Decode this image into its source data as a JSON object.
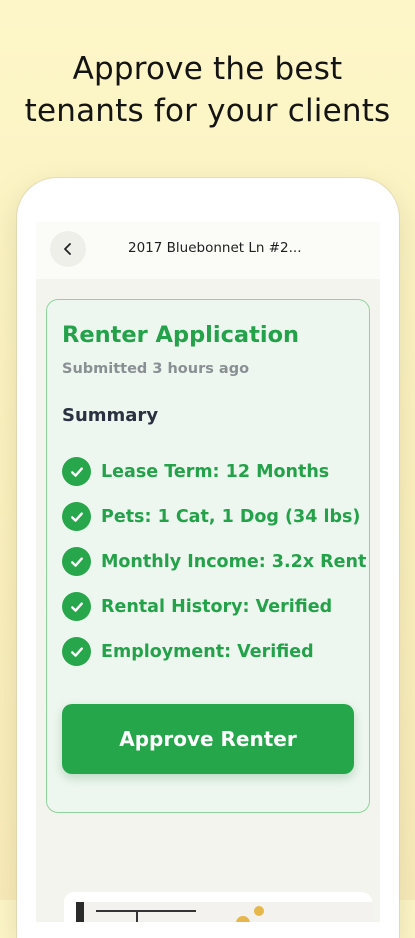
{
  "headline": {
    "line1": "Approve the best",
    "line2": "tenants for your clients"
  },
  "nav": {
    "title": "2017 Bluebonnet Ln #2..."
  },
  "application": {
    "title": "Renter Application",
    "submitted": "Submitted 3 hours ago",
    "summary_heading": "Summary",
    "items": [
      {
        "label": "Lease Term: 12 Months"
      },
      {
        "label": "Pets: 1 Cat, 1 Dog (34 lbs)"
      },
      {
        "label": "Monthly Income: 3.2x Rent"
      },
      {
        "label": "Rental History: Verified"
      },
      {
        "label": "Employment: Verified"
      }
    ],
    "approve_label": "Approve Renter"
  },
  "colors": {
    "accent_green": "#26a64b",
    "card_bg": "#eef7ef",
    "card_border": "#8fd49c",
    "background": "#fdf6c8"
  },
  "icons": {
    "back": "chevron-left-icon",
    "check": "check-circle-icon"
  }
}
